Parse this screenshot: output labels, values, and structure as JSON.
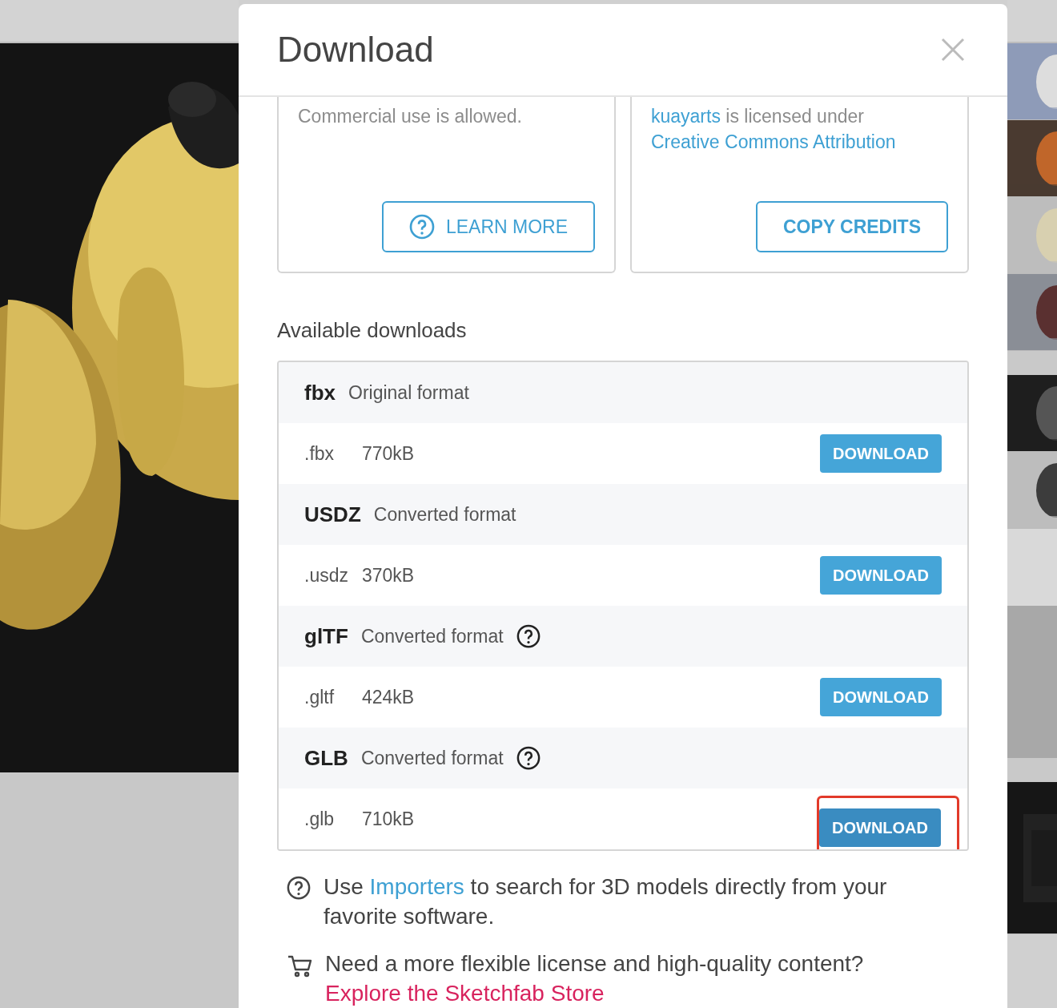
{
  "modal": {
    "title": "Download"
  },
  "license": {
    "terms": "Commercial use is allowed.",
    "learn_more": "LEARN MORE",
    "author": "kuayarts",
    "credit_text": "is licensed under",
    "license_name": "Creative Commons Attribution",
    "copy_button": "COPY CREDITS"
  },
  "downloads": {
    "heading": "Available downloads",
    "groups": [
      {
        "format": "fbx",
        "description": "Original format",
        "help": false,
        "files": [
          {
            "extension": ".fbx",
            "size": "770kB",
            "button": "DOWNLOAD",
            "highlighted": false
          }
        ]
      },
      {
        "format": "USDZ",
        "description": "Converted format",
        "help": false,
        "files": [
          {
            "extension": ".usdz",
            "size": "370kB",
            "button": "DOWNLOAD",
            "highlighted": false
          }
        ]
      },
      {
        "format": "glTF",
        "description": "Converted format",
        "help": true,
        "files": [
          {
            "extension": ".gltf",
            "size": "424kB",
            "button": "DOWNLOAD",
            "highlighted": false
          }
        ]
      },
      {
        "format": "GLB",
        "description": "Converted format",
        "help": true,
        "files": [
          {
            "extension": ".glb",
            "size": "710kB",
            "button": "DOWNLOAD",
            "highlighted": true
          }
        ]
      }
    ]
  },
  "notes": [
    {
      "kind": "help",
      "before": "Use",
      "link": "Importers",
      "after": "to search for 3D models directly from your favorite software."
    },
    {
      "kind": "cart",
      "before": "Need a more flexible license and high-quality content?",
      "link": "Explore the Sketchfab Store"
    }
  ]
}
